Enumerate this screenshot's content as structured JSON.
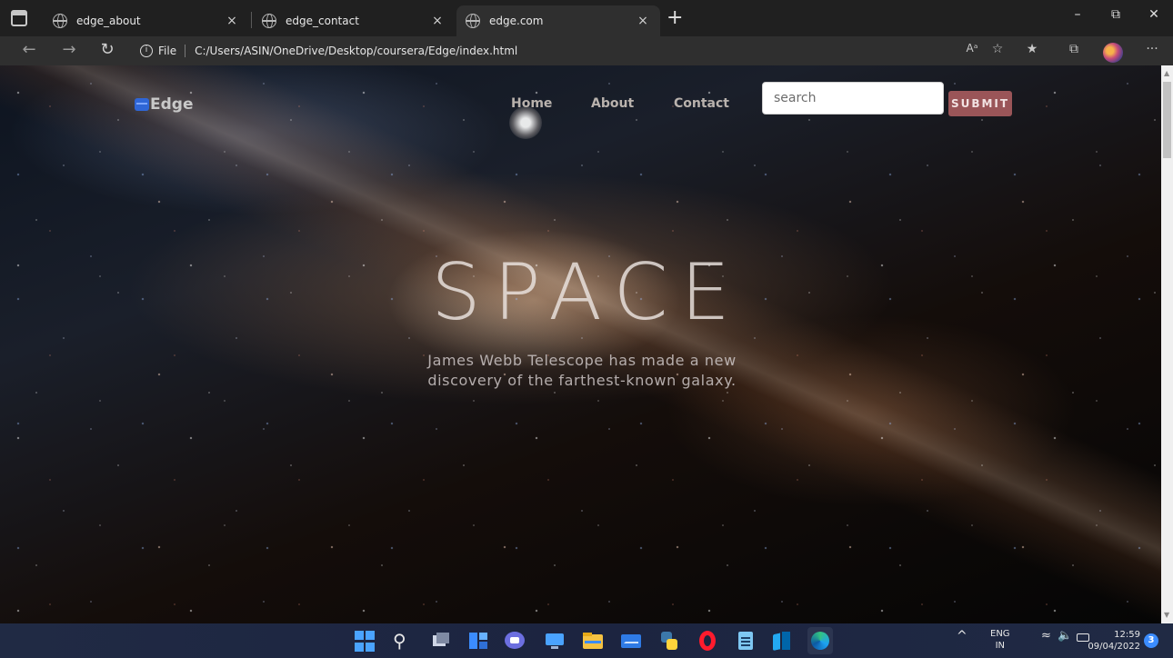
{
  "browser": {
    "tabs": [
      {
        "title": "edge_about"
      },
      {
        "title": "edge_contact"
      },
      {
        "title": "edge.com"
      }
    ],
    "close_glyph": "×",
    "new_tab_glyph": "+",
    "window_controls": {
      "minimize": "–",
      "restore": "⧉",
      "close": "✕"
    },
    "address": {
      "info_glyph": "i",
      "scheme_label": "File",
      "url": "C:/Users/ASIN/OneDrive/Desktop/coursera/Edge/index.html"
    },
    "toolbar_icons": [
      "read-aloud-icon",
      "add-favorite-icon",
      "favorites-icon",
      "collections-icon",
      "profile-icon",
      "more-icon"
    ],
    "read_aloud_text": "Aᵃ",
    "more_glyph": "···"
  },
  "page": {
    "logo_text": "Edge",
    "nav": [
      {
        "label": "Home"
      },
      {
        "label": "About"
      },
      {
        "label": "Contact"
      }
    ],
    "search": {
      "placeholder": "search"
    },
    "submit_label": "SUBMIT",
    "hero_title": "SPACE",
    "hero_subtitle_line1": "James Webb Telescope has made a new",
    "hero_subtitle_line2": "discovery of the farthest-known galaxy."
  },
  "taskbar": {
    "apps": [
      "start-icon",
      "search-icon",
      "task-view-icon",
      "widgets-icon",
      "teams-chat-icon",
      "desktop-icon",
      "file-explorer-icon",
      "mail-icon",
      "python-icon",
      "opera-icon",
      "notepad-icon",
      "vscode-icon",
      "edge-icon"
    ],
    "tray_chevron": "^",
    "language": {
      "line1": "ENG",
      "line2": "IN"
    },
    "time": "12:59",
    "date": "09/04/2022",
    "notification_count": "3"
  }
}
